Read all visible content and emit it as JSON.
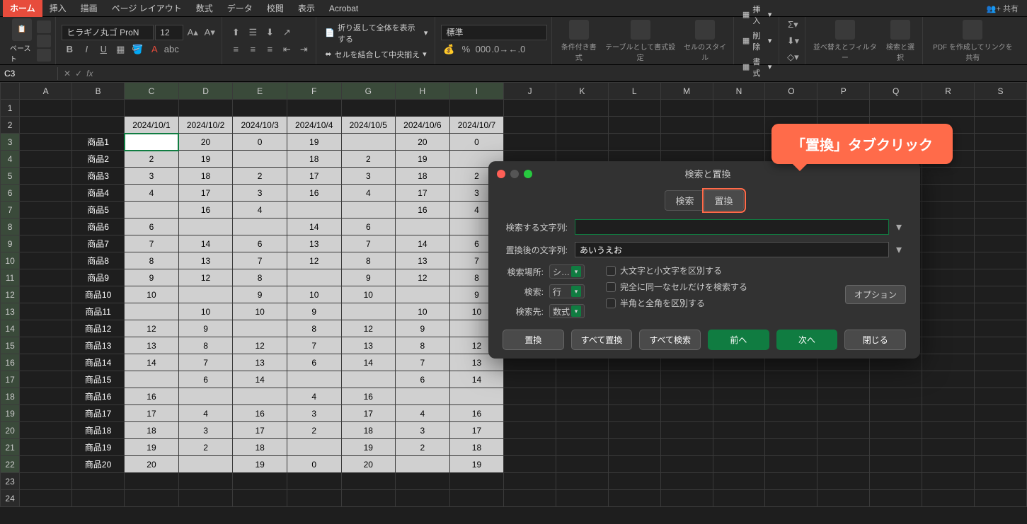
{
  "menu": {
    "tabs": [
      "ホーム",
      "挿入",
      "描画",
      "ページ レイアウト",
      "数式",
      "データ",
      "校閲",
      "表示",
      "Acrobat"
    ],
    "share": "共有"
  },
  "ribbon": {
    "paste": "ペースト",
    "font_name": "ヒラギノ丸ゴ ProN",
    "font_size": "12",
    "wrap": "折り返して全体を表示する",
    "merge": "セルを結合して中央揃え",
    "number_format": "標準",
    "cond_fmt": "条件付き書式",
    "table_fmt": "テーブルとして書式設定",
    "cell_style": "セルのスタイル",
    "insert": "挿入",
    "delete": "削除",
    "format": "書式",
    "sort": "並べ替えとフィルター",
    "find": "検索と選択",
    "pdf": "PDF を作成してリンクを共有"
  },
  "formula": {
    "cell_ref": "C3"
  },
  "columns": [
    "A",
    "B",
    "C",
    "D",
    "E",
    "F",
    "G",
    "H",
    "I",
    "J",
    "K",
    "L",
    "M",
    "N",
    "O",
    "P",
    "Q",
    "R",
    "S"
  ],
  "chart_data": {
    "type": "table",
    "headers": [
      "",
      "2024/10/1",
      "2024/10/2",
      "2024/10/3",
      "2024/10/4",
      "2024/10/5",
      "2024/10/6",
      "2024/10/7"
    ],
    "rows": [
      [
        "商品1",
        "",
        "20",
        "0",
        "19",
        "",
        "20",
        "0"
      ],
      [
        "商品2",
        "2",
        "19",
        "",
        "18",
        "2",
        "19",
        ""
      ],
      [
        "商品3",
        "3",
        "18",
        "2",
        "17",
        "3",
        "18",
        "2"
      ],
      [
        "商品4",
        "4",
        "17",
        "3",
        "16",
        "4",
        "17",
        "3"
      ],
      [
        "商品5",
        "",
        "16",
        "4",
        "",
        "",
        "16",
        "4"
      ],
      [
        "商品6",
        "6",
        "",
        "",
        "14",
        "6",
        "",
        ""
      ],
      [
        "商品7",
        "7",
        "14",
        "6",
        "13",
        "7",
        "14",
        "6"
      ],
      [
        "商品8",
        "8",
        "13",
        "7",
        "12",
        "8",
        "13",
        "7"
      ],
      [
        "商品9",
        "9",
        "12",
        "8",
        "",
        "9",
        "12",
        "8"
      ],
      [
        "商品10",
        "10",
        "",
        "9",
        "10",
        "10",
        "",
        "9"
      ],
      [
        "商品11",
        "",
        "10",
        "10",
        "9",
        "",
        "10",
        "10"
      ],
      [
        "商品12",
        "12",
        "9",
        "",
        "8",
        "12",
        "9",
        ""
      ],
      [
        "商品13",
        "13",
        "8",
        "12",
        "7",
        "13",
        "8",
        "12"
      ],
      [
        "商品14",
        "14",
        "7",
        "13",
        "6",
        "14",
        "7",
        "13"
      ],
      [
        "商品15",
        "",
        "6",
        "14",
        "",
        "",
        "6",
        "14"
      ],
      [
        "商品16",
        "16",
        "",
        "",
        "4",
        "16",
        "",
        ""
      ],
      [
        "商品17",
        "17",
        "4",
        "16",
        "3",
        "17",
        "4",
        "16"
      ],
      [
        "商品18",
        "18",
        "3",
        "17",
        "2",
        "18",
        "3",
        "17"
      ],
      [
        "商品19",
        "19",
        "2",
        "18",
        "",
        "19",
        "2",
        "18"
      ],
      [
        "商品20",
        "20",
        "",
        "19",
        "0",
        "20",
        "",
        "19"
      ]
    ]
  },
  "dialog": {
    "title": "検索と置換",
    "tab_search": "検索",
    "tab_replace": "置換",
    "find_label": "検索する文字列:",
    "find_value": "",
    "replace_label": "置換後の文字列:",
    "replace_value": "あいうえお",
    "within_label": "検索場所:",
    "within_value": "シ…",
    "search_label": "検索:",
    "search_value": "行",
    "lookin_label": "検索先:",
    "lookin_value": "数式",
    "case": "大文字と小文字を区別する",
    "exact": "完全に同一なセルだけを検索する",
    "width": "半角と全角を区別する",
    "options": "オプション",
    "btn_replace": "置換",
    "btn_replace_all": "すべて置換",
    "btn_find_all": "すべて検索",
    "btn_prev": "前へ",
    "btn_next": "次へ",
    "btn_close": "閉じる"
  },
  "callout": "「置換」タブクリック"
}
